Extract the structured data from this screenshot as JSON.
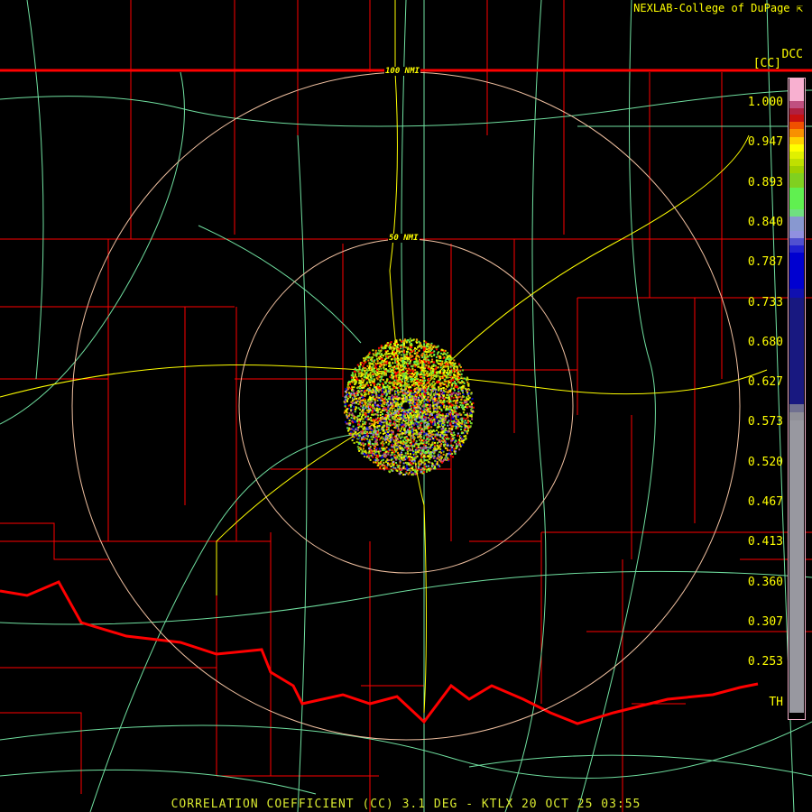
{
  "header": {
    "credit": "NEXLAB-College of DuPage",
    "product_code": "DCC",
    "unit": "[CC]"
  },
  "rings": [
    {
      "label": "50 NMI"
    },
    {
      "label": "100 NMI"
    }
  ],
  "legend": {
    "ticks": [
      "1.000",
      "0.947",
      "0.893",
      "0.840",
      "0.787",
      "0.733",
      "0.680",
      "0.627",
      "0.573",
      "0.520",
      "0.467",
      "0.413",
      "0.360",
      "0.307",
      "0.253",
      "TH"
    ],
    "colors": [
      "#f8b0d0",
      "#c05080",
      "#b02040",
      "#c81010",
      "#f05000",
      "#f89000",
      "#ffd000",
      "#ffff00",
      "#e0f000",
      "#c0e000",
      "#a0d000",
      "#80d020",
      "#60f050",
      "#70e080",
      "#8898d0",
      "#9090e0",
      "#5050d0",
      "#2020d0",
      "#0000d0",
      "#1010b0",
      "#181880",
      "#707090",
      "#909098",
      "#9898a0"
    ]
  },
  "caption": "CORRELATION COEFFICIENT (CC) 3.1 DEG - KTLX 20 OCT 25 03:55",
  "colors": {
    "county": "#ff0000",
    "road": "#70e0a0",
    "state": "#ff0000",
    "ring": "#f0c0a0",
    "highway": "#ffff00"
  }
}
